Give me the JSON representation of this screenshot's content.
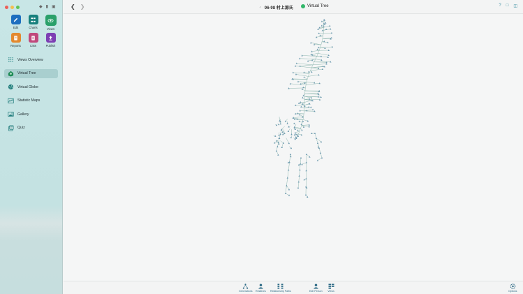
{
  "sidebar": {
    "apps": [
      {
        "name": "edit",
        "label": "Edit",
        "color": "#1e6fbf",
        "icon": "pencil-icon"
      },
      {
        "name": "charts",
        "label": "Charts",
        "color": "#17807d",
        "icon": "chart-tree-icon"
      },
      {
        "name": "views",
        "label": "Views",
        "color": "#2aa06a",
        "icon": "eye-icon",
        "selected": true
      },
      {
        "name": "reports",
        "label": "Reports",
        "color": "#e3892f",
        "icon": "document-icon"
      },
      {
        "name": "lists",
        "label": "Lists",
        "color": "#c0497c",
        "icon": "list-icon"
      },
      {
        "name": "publish",
        "label": "Publish",
        "color": "#7d3fb3",
        "icon": "upload-icon"
      }
    ],
    "nav": [
      {
        "name": "views-overview",
        "label": "Views Overview",
        "icon": "grid-icon",
        "color": "#2f8a8a"
      },
      {
        "name": "virtual-tree",
        "label": "Virtual Tree",
        "icon": "tree-icon",
        "color": "#1d8a55",
        "selected": true
      },
      {
        "name": "virtual-globe",
        "label": "Virtual Globe",
        "icon": "globe-icon",
        "color": "#1d7a7a"
      },
      {
        "name": "statistic-maps",
        "label": "Statistic Maps",
        "icon": "map-icon",
        "color": "#1d7a7a"
      },
      {
        "name": "gallery",
        "label": "Gallery",
        "icon": "photo-icon",
        "color": "#1d7a7a"
      },
      {
        "name": "quiz",
        "label": "Quiz",
        "icon": "quiz-icon",
        "color": "#1d7a7a"
      }
    ]
  },
  "header": {
    "person_name": "96-98 村上源氏",
    "view_title": "Virtual Tree"
  },
  "toolbar": {
    "items": [
      {
        "name": "generations",
        "label": "Generations",
        "icon": "generations-icon"
      },
      {
        "name": "relatives",
        "label": "Relatives",
        "icon": "relatives-icon"
      },
      {
        "name": "relationship-paths",
        "label": "Relationship Paths",
        "icon": "relationship-paths-icon"
      },
      {
        "name": "edit-person",
        "label": "Edit Person",
        "icon": "person-icon"
      },
      {
        "name": "views",
        "label": "Views",
        "icon": "views-icon"
      },
      {
        "name": "options",
        "label": "Options",
        "icon": "gear-icon"
      }
    ]
  },
  "colors": {
    "accent": "#2e6b86",
    "tree_node": "#6f9bb0",
    "tree_edge": "#8fb8b0"
  }
}
